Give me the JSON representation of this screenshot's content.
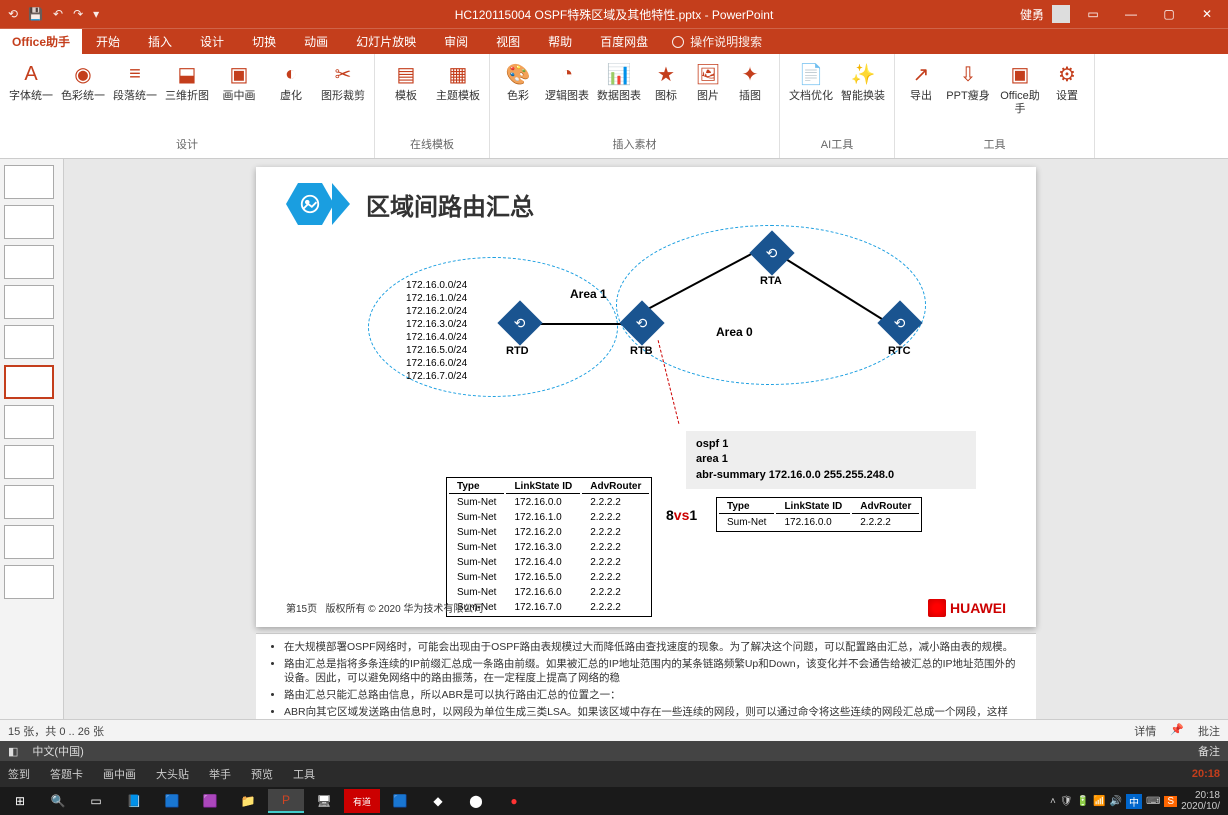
{
  "title_bar": {
    "doc_title": "HC120115004 OSPF特殊区域及其他特性.pptx - PowerPoint",
    "user_name": "健勇"
  },
  "menu": {
    "office_tab": "Office助手",
    "tabs": [
      "开始",
      "插入",
      "设计",
      "切换",
      "动画",
      "幻灯片放映",
      "审阅",
      "视图",
      "帮助",
      "百度网盘"
    ],
    "tell_me": "操作说明搜索"
  },
  "ribbon": {
    "groups": [
      {
        "label": "设计",
        "buttons": [
          "字体统一",
          "色彩统一",
          "段落统一",
          "三维折图",
          "画中画",
          "虚化",
          "图形裁剪"
        ]
      },
      {
        "label": "在线模板",
        "buttons": [
          "模板",
          "主题模板"
        ]
      },
      {
        "label": "插入素材",
        "buttons": [
          "色彩",
          "逻辑图表",
          "数据图表",
          "图标",
          "图片",
          "插图"
        ]
      },
      {
        "label": "AI工具",
        "buttons": [
          "文档优化",
          "智能换装"
        ]
      },
      {
        "label": "工具",
        "buttons": [
          "导出",
          "PPT瘦身",
          "Office助手",
          "设置"
        ]
      }
    ]
  },
  "slide": {
    "title": "区域间路由汇总",
    "area1_label": "Area 1",
    "area0_label": "Area 0",
    "routers": {
      "rta": "RTA",
      "rtb": "RTB",
      "rtc": "RTC",
      "rtd": "RTD"
    },
    "ip_list": [
      "172.16.0.0/24",
      "172.16.1.0/24",
      "172.16.2.0/24",
      "172.16.3.0/24",
      "172.16.4.0/24",
      "172.16.5.0/24",
      "172.16.6.0/24",
      "172.16.7.0/24"
    ],
    "config": [
      "ospf 1",
      "area 1",
      "abr-summary 172.16.0.0 255.255.248.0"
    ],
    "vs_a": "8",
    "vs_mid": "vs",
    "vs_b": "1",
    "table_left": {
      "headers": [
        "Type",
        "LinkState ID",
        "AdvRouter"
      ],
      "rows": [
        [
          "Sum-Net",
          "172.16.0.0",
          "2.2.2.2"
        ],
        [
          "Sum-Net",
          "172.16.1.0",
          "2.2.2.2"
        ],
        [
          "Sum-Net",
          "172.16.2.0",
          "2.2.2.2"
        ],
        [
          "Sum-Net",
          "172.16.3.0",
          "2.2.2.2"
        ],
        [
          "Sum-Net",
          "172.16.4.0",
          "2.2.2.2"
        ],
        [
          "Sum-Net",
          "172.16.5.0",
          "2.2.2.2"
        ],
        [
          "Sum-Net",
          "172.16.6.0",
          "2.2.2.2"
        ],
        [
          "Sum-Net",
          "172.16.7.0",
          "2.2.2.2"
        ]
      ]
    },
    "table_right": {
      "headers": [
        "Type",
        "LinkState ID",
        "AdvRouter"
      ],
      "rows": [
        [
          "Sum-Net",
          "172.16.0.0",
          "2.2.2.2"
        ]
      ]
    },
    "footer_page": "第15页",
    "footer_copy": "版权所有 © 2020 华为技术有限公司",
    "huawei": "HUAWEI"
  },
  "notes": {
    "items": [
      "在大规模部署OSPF网络时，可能会出现由于OSPF路由表规模过大而降低路由查找速度的现象。为了解决这个问题，可以配置路由汇总，减小路由表的规模。",
      "路由汇总是指将多条连续的IP前缀汇总成一条路由前缀。如果被汇总的IP地址范围内的某条链路频繁Up和Down，该变化并不会通告给被汇总的IP地址范围外的设备。因此，可以避免网络中的路由振荡，在一定程度上提高了网络的稳",
      "路由汇总只能汇总路由信息，所以ABR是可以执行路由汇总的位置之一：",
      "ABR向其它区域发送路由信息时，以网段为单位生成三类LSA。如果该区域中存在一些连续的网段，则可以通过命令将这些连续的网段汇总成一个网段，这样ABR只发送一条汇总后的三类LSA，所有属于命令指定的汇总网段范"
    ]
  },
  "review_bar": {
    "left": "15 张，共 0 .. 26 张",
    "right": [
      "详情",
      "批注"
    ]
  },
  "status_bar": {
    "lang": "中文(中国)",
    "notes_btn": "备注"
  },
  "sec_toolbar": {
    "items": [
      "签到",
      "答题卡",
      "画中画",
      "大头贴",
      "举手",
      "预览",
      "工具"
    ],
    "time": "20:18"
  },
  "systray": {
    "clock_time": "20:18",
    "clock_date": "2020/10/",
    "ime": "中"
  }
}
